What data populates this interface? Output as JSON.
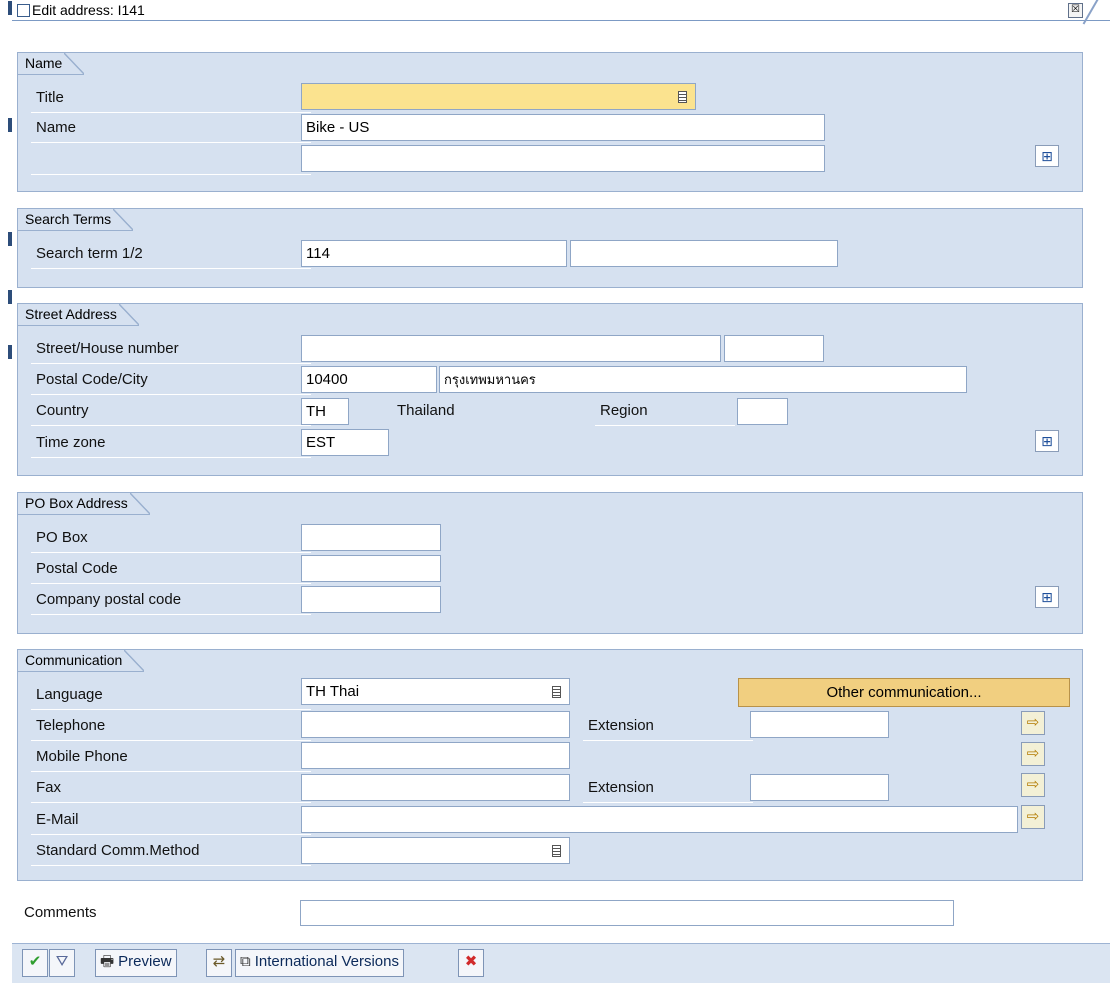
{
  "window": {
    "title": "Edit address:  I141",
    "close_glyph": "☒"
  },
  "name_group": {
    "caption": "Name",
    "title_label": "Title",
    "title_value": "",
    "name_label": "Name",
    "name_value": "Bike - US",
    "name2_value": ""
  },
  "search_group": {
    "caption": "Search Terms",
    "term_label": "Search term 1/2",
    "term1_value": "114",
    "term2_value": ""
  },
  "street_group": {
    "caption": "Street Address",
    "street_label": "Street/House number",
    "street_value": "",
    "house_value": "",
    "postal_city_label": "Postal Code/City",
    "postal_value": "10400",
    "city_value": "กรุงเทพมหานคร",
    "country_label": "Country",
    "country_value": "TH",
    "country_name": "Thailand",
    "region_label": "Region",
    "region_value": "",
    "timezone_label": "Time zone",
    "timezone_value": "EST"
  },
  "pobox_group": {
    "caption": "PO Box Address",
    "pobox_label": "PO Box",
    "pobox_value": "",
    "postal_label": "Postal Code",
    "postal_value": "",
    "company_postal_label": "Company postal code",
    "company_postal_value": ""
  },
  "comm_group": {
    "caption": "Communication",
    "language_label": "Language",
    "language_value": "TH Thai",
    "other_comm_button": "Other communication...",
    "telephone_label": "Telephone",
    "telephone_value": "",
    "extension_label": "Extension",
    "tel_ext_value": "",
    "mobile_label": "Mobile Phone",
    "mobile_value": "",
    "fax_label": "Fax",
    "fax_value": "",
    "fax_extension_label": "Extension",
    "fax_ext_value": "",
    "email_label": "E-Mail",
    "email_value": "",
    "std_comm_label": "Standard Comm.Method",
    "std_comm_value": ""
  },
  "comments": {
    "label": "Comments",
    "value": ""
  },
  "toolbar": {
    "confirm_glyph": "✔",
    "filter_glyph": "⛛",
    "preview_label": "Preview",
    "preview_glyph": "🖶",
    "other_glyph": "⇄",
    "intl_label": "International Versions",
    "intl_glyph": "⧉",
    "cancel_glyph": "✖"
  },
  "icons": {
    "more_fields": "⊞",
    "arrow_right": "⇨"
  },
  "colors": {
    "group_bg": "#d6e1f0",
    "required_field": "#fbe38f",
    "button_gold": "#f1cf80",
    "confirm_green": "#2f9e2f",
    "cancel_red": "#d12b2b"
  }
}
